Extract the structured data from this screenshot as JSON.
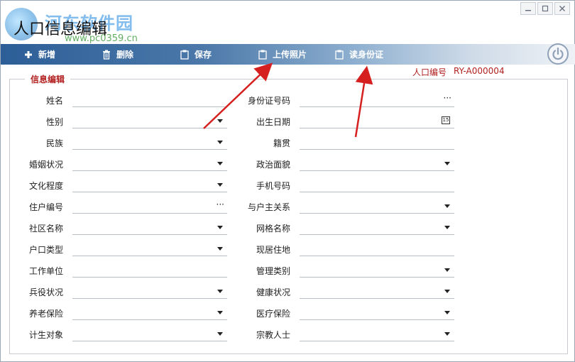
{
  "window": {
    "title": "人口信息编辑"
  },
  "watermark": {
    "text": "河东软件园",
    "url": "www.pc0359.cn"
  },
  "toolbar": {
    "items": [
      {
        "label": "新增",
        "icon": "plus-icon"
      },
      {
        "label": "删除",
        "icon": "trash-icon"
      },
      {
        "label": "保存",
        "icon": "clipboard-icon"
      },
      {
        "label": "上传照片",
        "icon": "clipboard-icon"
      },
      {
        "label": "读身份证",
        "icon": "clipboard-icon"
      }
    ]
  },
  "record": {
    "id_label": "人口编号",
    "id_value": "RY-A000004"
  },
  "group": {
    "title": "信息编辑"
  },
  "left_fields": [
    {
      "label": "姓名",
      "control": "text"
    },
    {
      "label": "性别",
      "control": "dropdown"
    },
    {
      "label": "民族",
      "control": "dropdown"
    },
    {
      "label": "婚姻状况",
      "control": "dropdown"
    },
    {
      "label": "文化程度",
      "control": "dropdown"
    },
    {
      "label": "住户编号",
      "control": "ellipsis"
    },
    {
      "label": "社区名称",
      "control": "dropdown"
    },
    {
      "label": "户口类型",
      "control": "dropdown"
    },
    {
      "label": "工作单位",
      "control": "text"
    },
    {
      "label": "兵役状况",
      "control": "dropdown"
    },
    {
      "label": "养老保险",
      "control": "dropdown"
    },
    {
      "label": "计生对象",
      "control": "dropdown"
    }
  ],
  "right_fields": [
    {
      "label": "身份证号码",
      "control": "ellipsis"
    },
    {
      "label": "出生日期",
      "control": "date"
    },
    {
      "label": "籍贯",
      "control": "text"
    },
    {
      "label": "政治面貌",
      "control": "dropdown"
    },
    {
      "label": "手机号码",
      "control": "text"
    },
    {
      "label": "与户主关系",
      "control": "dropdown"
    },
    {
      "label": "网格名称",
      "control": "dropdown"
    },
    {
      "label": "现居住地",
      "control": "text"
    },
    {
      "label": "管理类别",
      "control": "dropdown"
    },
    {
      "label": "健康状况",
      "control": "dropdown"
    },
    {
      "label": "医疗保险",
      "control": "dropdown"
    },
    {
      "label": "宗教人士",
      "control": "dropdown"
    }
  ],
  "icons": {
    "date_picker_text": "15",
    "ellipsis_text": "···"
  },
  "colors": {
    "toolbar_start": "#2c5e97",
    "accent_red": "#b22020",
    "annotation_arrow": "#d62020"
  }
}
